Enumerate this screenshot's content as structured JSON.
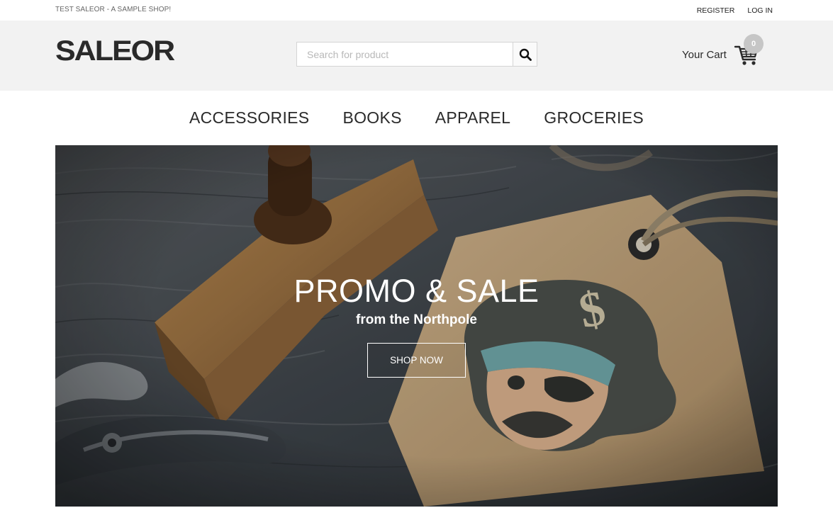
{
  "topbar": {
    "tagline": "TEST SALEOR - A SAMPLE SHOP!",
    "register_label": "REGISTER",
    "login_label": "LOG IN"
  },
  "header": {
    "logo_text": "SALEOR",
    "search": {
      "placeholder": "Search for product",
      "value": "",
      "icon": "search-icon"
    },
    "cart": {
      "label": "Your Cart",
      "count": "0",
      "icon": "cart-icon"
    }
  },
  "nav": {
    "items": [
      {
        "label": "ACCESSORIES"
      },
      {
        "label": "BOOKS"
      },
      {
        "label": "APPAREL"
      },
      {
        "label": "GROCERIES"
      }
    ]
  },
  "hero": {
    "title": "PROMO & SALE",
    "subtitle": "from the Northpole",
    "button_label": "SHOP NOW"
  },
  "colors": {
    "header_bg": "#f2f2f2",
    "text_dark": "#2a2a2a",
    "badge": "#c6c6c6"
  }
}
